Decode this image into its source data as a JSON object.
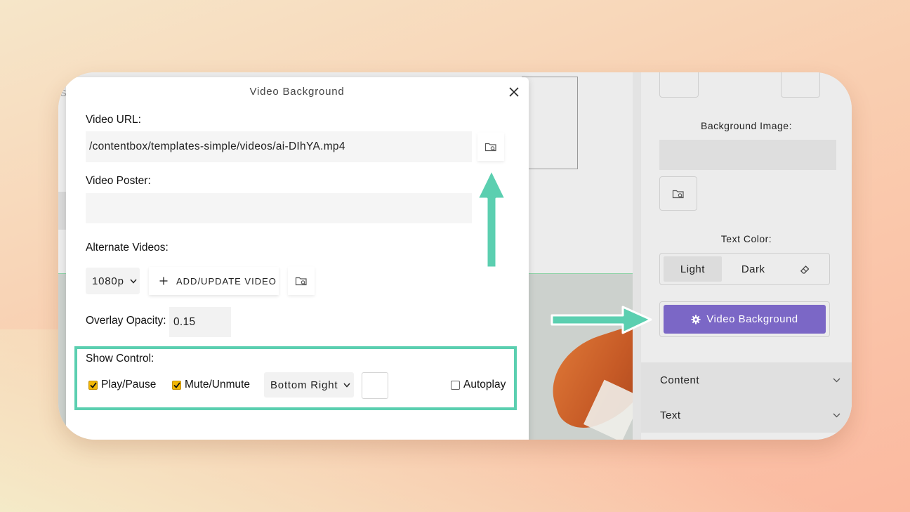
{
  "modal": {
    "title": "Video Background",
    "video_url_label": "Video URL:",
    "video_url_value": "/contentbox/templates-simple/videos/ai-DIhYA.mp4",
    "video_poster_label": "Video Poster:",
    "video_poster_value": "",
    "alternate_videos_label": "Alternate Videos:",
    "resolution_selected": "1080p",
    "add_update_label": "ADD/UPDATE VIDEO",
    "overlay_opacity_label": "Overlay Opacity:",
    "overlay_opacity_value": "0.15",
    "show_control_label": "Show Control:",
    "play_pause_label": "Play/Pause",
    "play_pause_checked": true,
    "mute_unmute_label": "Mute/Unmute",
    "mute_unmute_checked": true,
    "control_position_selected": "Bottom Right",
    "autoplay_label": "Autoplay",
    "autoplay_checked": false
  },
  "panel": {
    "background_image_label": "Background Image:",
    "text_color_label": "Text Color:",
    "light_label": "Light",
    "dark_label": "Dark",
    "video_background_button": "Video Background",
    "sections": [
      {
        "label": "Content"
      },
      {
        "label": "Text"
      }
    ]
  },
  "canvas": {
    "placeholder_char": "S"
  },
  "colors": {
    "accent_purple": "#7b67c6",
    "highlight_teal": "#5bcfb0",
    "checkbox_yellow": "#f2b705"
  },
  "icons": [
    "close-icon",
    "folder-search-icon",
    "plus-icon",
    "gear-icon",
    "eraser-icon",
    "chevron-down-icon"
  ]
}
